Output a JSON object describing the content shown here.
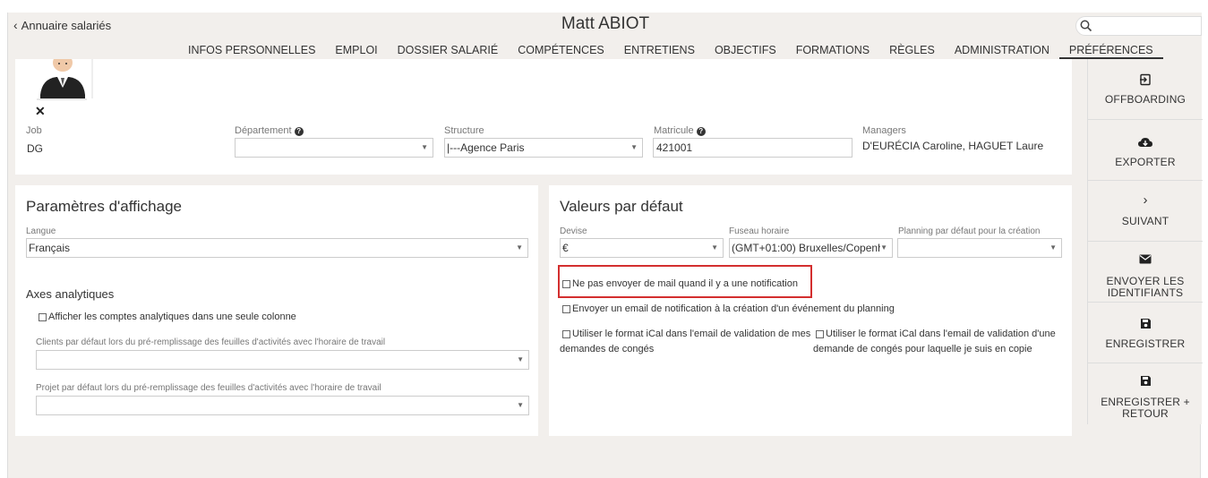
{
  "header": {
    "back_label": "Annuaire salariés",
    "title": "Matt ABIOT",
    "search_placeholder": ""
  },
  "tabs": [
    {
      "label": "INFOS PERSONNELLES"
    },
    {
      "label": "EMPLOI"
    },
    {
      "label": "DOSSIER SALARIÉ"
    },
    {
      "label": "COMPÉTENCES"
    },
    {
      "label": "ENTRETIENS"
    },
    {
      "label": "OBJECTIFS"
    },
    {
      "label": "FORMATIONS"
    },
    {
      "label": "RÈGLES"
    },
    {
      "label": "ADMINISTRATION"
    },
    {
      "label": "PRÉFÉRENCES",
      "active": true
    }
  ],
  "profile": {
    "job_label": "Job",
    "job_value": "DG",
    "departement_label": "Département",
    "departement_value": "",
    "structure_label": "Structure",
    "structure_value": "|---Agence Paris",
    "matricule_label": "Matricule",
    "matricule_value": "421001",
    "managers_label": "Managers",
    "managers_value": "D'EURÉCIA Caroline, HAGUET Laure",
    "remove_photo": "✕"
  },
  "display_params": {
    "title": "Paramètres d'affichage",
    "langue_label": "Langue",
    "langue_value": "Français",
    "axes_title": "Axes analytiques",
    "afficher_comptes_label": "Afficher les comptes analytiques dans une seule colonne",
    "clients_label": "Clients par défaut lors du pré-remplissage des feuilles d'activités avec l'horaire de travail",
    "clients_value": "",
    "projet_label": "Projet par défaut lors du pré-remplissage des feuilles d'activités avec l'horaire de travail",
    "projet_value": ""
  },
  "defaults": {
    "title": "Valeurs par défaut",
    "devise_label": "Devise",
    "devise_value": "€",
    "fuseau_label": "Fuseau horaire",
    "fuseau_value": "(GMT+01:00) Bruxelles/Copenh",
    "planning_label": "Planning par défaut pour la création",
    "planning_value": "",
    "no_mail_label": "Ne pas envoyer de mail quand il y a une notification",
    "email_planning_label": "Envoyer un email de notification à la création d'un événement du planning",
    "ical_mes_demandes_label_1": "Utiliser le format iCal dans l'email de validation de mes",
    "ical_mes_demandes_label_2": "demandes de congés",
    "ical_copie_label_1": "Utiliser le format iCal dans l'email de validation d'une",
    "ical_copie_label_2": "demande de congés pour laquelle je suis en copie"
  },
  "sidebar": {
    "offboarding": "OFFBOARDING",
    "exporter": "EXPORTER",
    "suivant": "SUIVANT",
    "envoyer_1": "ENVOYER LES",
    "envoyer_2": "IDENTIFIANTS",
    "enregistrer": "ENREGISTRER",
    "enregistrer_retour_1": "ENREGISTRER +",
    "enregistrer_retour_2": "RETOUR"
  },
  "colors": {
    "highlight": "#d32f2f",
    "background": "#f2efec"
  }
}
